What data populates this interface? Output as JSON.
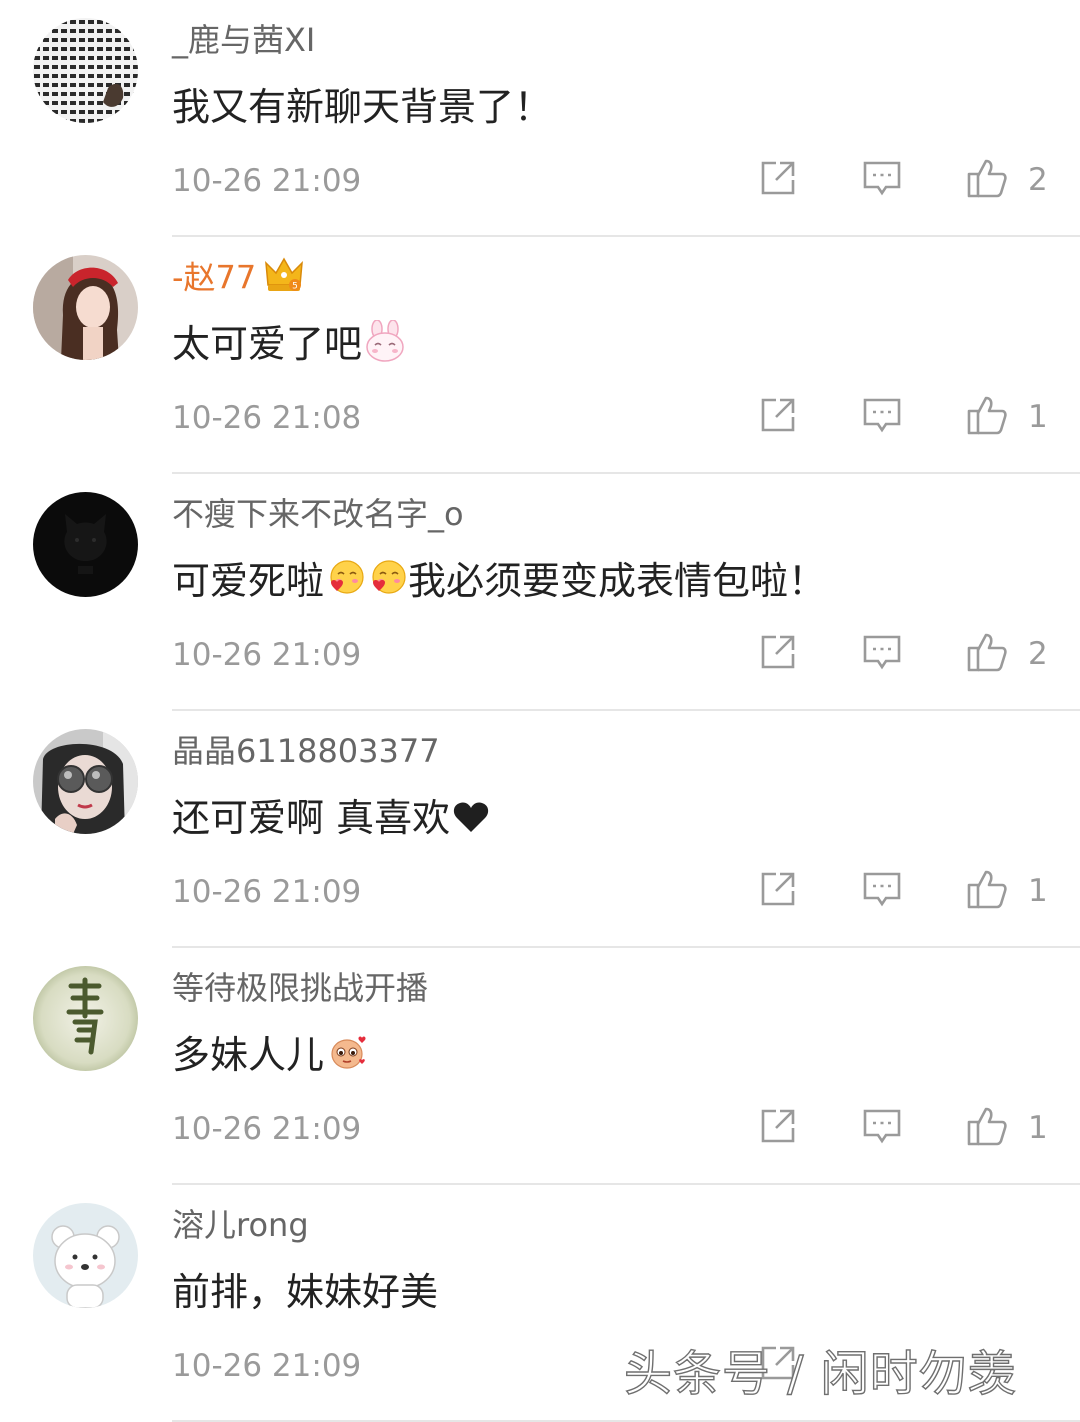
{
  "comments": [
    {
      "username": "_鹿与茜XI",
      "text": "我又有新聊天背景了！",
      "time": "10-26 21:09",
      "likes": "2",
      "avatar": "pattern-avatar"
    },
    {
      "username": "-赵77",
      "vip_icon": "crown-badge-icon",
      "text": "太可爱了吧",
      "emoji": "bunny-emoji-icon",
      "time": "10-26 21:08",
      "likes": "1",
      "avatar": "girl-avatar"
    },
    {
      "username": "不瘦下来不改名字_o",
      "text_a": "可爱死啦",
      "emoji": "blush-emoji-icon",
      "text_b": "我必须要变成表情包啦！",
      "time": "10-26 21:09",
      "likes": "2",
      "avatar": "black-cat-avatar"
    },
    {
      "username": "晶晶6118803377",
      "text": "还可爱啊 真喜欢",
      "emoji": "heart-icon",
      "time": "10-26 21:09",
      "likes": "1",
      "avatar": "sunglasses-avatar"
    },
    {
      "username": "等待极限挑战开播",
      "text": "多妹人儿",
      "emoji": "cute-face-emoji-icon",
      "time": "10-26 21:09",
      "likes": "1",
      "avatar": "calligraphy-avatar"
    },
    {
      "username": "溶儿rong",
      "text": "前排，妹妹好美",
      "time": "10-26 21:09",
      "likes": "",
      "avatar": "polar-bear-avatar"
    }
  ],
  "watermark": "头条号 / 闲时勿羡",
  "colors": {
    "vip_name": "#e8762c",
    "meta_gray": "#9a9a9a",
    "divider": "#e6e6e6"
  }
}
